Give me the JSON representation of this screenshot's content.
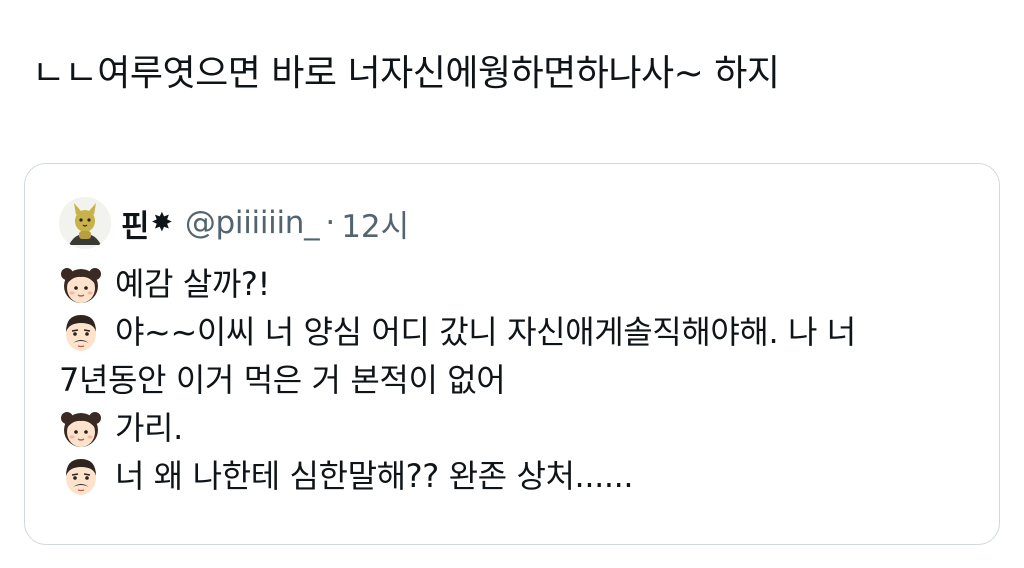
{
  "tweet": {
    "text": "ㄴㄴ여루엿으면 바로 너자신에웡하면하나사~ 하지"
  },
  "quote": {
    "avatar_icon": "cat-avatar-icon",
    "display_name": "핀",
    "name_symbol": "✸",
    "handle": "@piiiiiin_",
    "separator": "·",
    "time": "12시",
    "lines": [
      {
        "emoji": "girl-emoji",
        "text": "예감 살까?!"
      },
      {
        "emoji": "man-emoji",
        "text": "야~~이씨 너 양심 어디 갔니 자신애게솔직해야해. 나 너"
      },
      {
        "emoji": "",
        "text": "7년동안 이거 먹은 거 본적이 없어"
      },
      {
        "emoji": "girl-emoji",
        "text": "가리."
      },
      {
        "emoji": "man-emoji",
        "text": "너 왜 나한테 심한말해?? 완존 상처......"
      }
    ]
  },
  "colors": {
    "text": "#0f1419",
    "muted": "#536471",
    "border": "#cfd9de"
  }
}
